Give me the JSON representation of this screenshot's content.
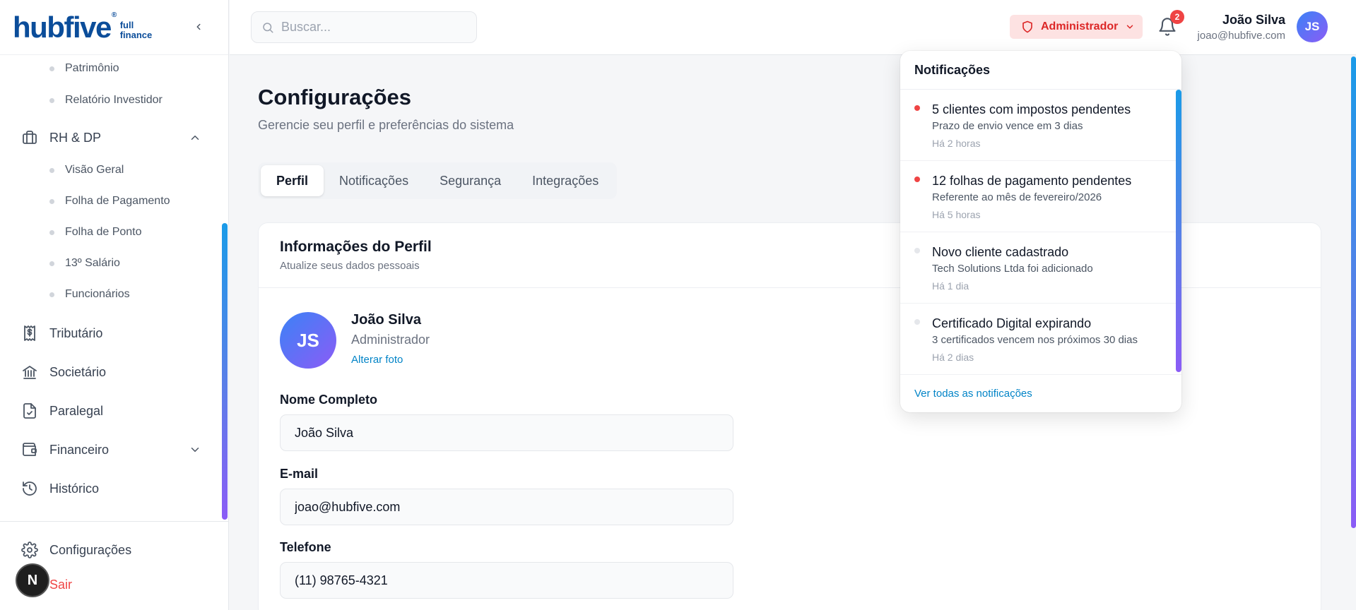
{
  "brand": {
    "name": "hubfive",
    "reg": "®",
    "sub_line1": "full",
    "sub_line2": "finance"
  },
  "sidebar": {
    "sub_items_top": [
      {
        "label": "Patrimônio"
      },
      {
        "label": "Relatório Investidor"
      }
    ],
    "rh_dp": {
      "label": "RH & DP"
    },
    "rh_sub": [
      {
        "label": "Visão Geral"
      },
      {
        "label": "Folha de Pagamento"
      },
      {
        "label": "Folha de Ponto"
      },
      {
        "label": "13º Salário"
      },
      {
        "label": "Funcionários"
      }
    ],
    "items": [
      {
        "label": "Tributário"
      },
      {
        "label": "Societário"
      },
      {
        "label": "Paralegal"
      },
      {
        "label": "Financeiro"
      },
      {
        "label": "Histórico"
      }
    ],
    "settings": {
      "label": "Configurações"
    },
    "logout": {
      "label": "Sair"
    },
    "badge": "N"
  },
  "header": {
    "search_placeholder": "Buscar...",
    "role": "Administrador",
    "notif_count": "2",
    "user_name": "João Silva",
    "user_email": "joao@hubfive.com",
    "user_initials": "JS"
  },
  "main": {
    "title": "Configurações",
    "subtitle": "Gerencie seu perfil e preferências do sistema",
    "tabs": [
      {
        "label": "Perfil"
      },
      {
        "label": "Notificações"
      },
      {
        "label": "Segurança"
      },
      {
        "label": "Integrações"
      }
    ],
    "card": {
      "title": "Informações do Perfil",
      "subtitle": "Atualize seus dados pessoais",
      "initials": "JS",
      "name": "João Silva",
      "role": "Administrador",
      "change_photo": "Alterar foto",
      "fields": [
        {
          "label": "Nome Completo",
          "value": "João Silva"
        },
        {
          "label": "E-mail",
          "value": "joao@hubfive.com"
        },
        {
          "label": "Telefone",
          "value": "(11) 98765-4321"
        }
      ]
    }
  },
  "notifications": {
    "title": "Notificações",
    "items": [
      {
        "title": "5 clientes com impostos pendentes",
        "desc": "Prazo de envio vence em 3 dias",
        "time": "Há 2 horas",
        "unread": true
      },
      {
        "title": "12 folhas de pagamento pendentes",
        "desc": "Referente ao mês de fevereiro/2026",
        "time": "Há 5 horas",
        "unread": true
      },
      {
        "title": "Novo cliente cadastrado",
        "desc": "Tech Solutions Ltda foi adicionado",
        "time": "Há 1 dia",
        "unread": false
      },
      {
        "title": "Certificado Digital expirando",
        "desc": "3 certificados vencem nos próximos 30 dias",
        "time": "Há 2 dias",
        "unread": false
      }
    ],
    "view_all": "Ver todas as notificações"
  },
  "colors": {
    "brand": "#0b4d9a",
    "accent": "#0284c7",
    "danger": "#ef4444",
    "unread_dot": "#ef4444",
    "read_dot": "#e5e7eb"
  }
}
